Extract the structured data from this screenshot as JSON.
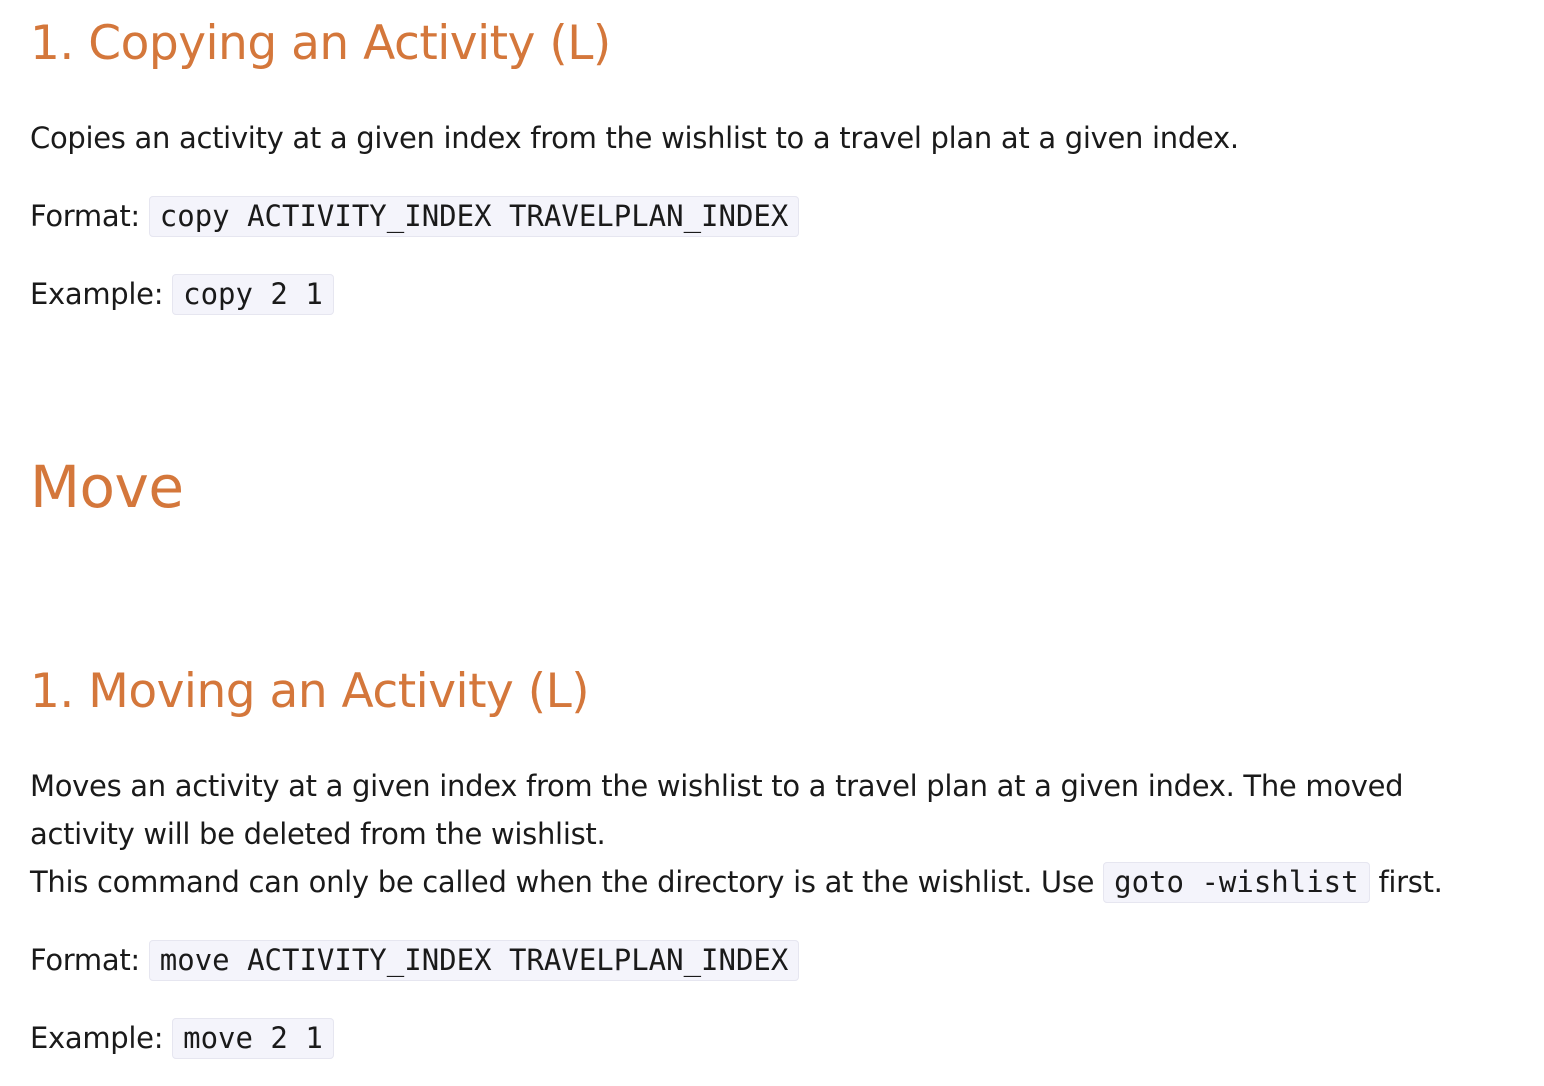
{
  "copy_section": {
    "heading": "1. Copying an Activity (L)",
    "description": "Copies an activity at a given index from the wishlist to a travel plan at a given index.",
    "format_label": "Format:",
    "format_code": "copy ACTIVITY_INDEX TRAVELPLAN_INDEX",
    "example_label": "Example:",
    "example_code": "copy 2 1"
  },
  "move_header": {
    "title": "Move"
  },
  "move_section": {
    "heading": "1. Moving an Activity (L)",
    "description_line1": "Moves an activity at a given index from the wishlist to a travel plan at a given index. The moved",
    "description_line2": "activity will be deleted from the wishlist.",
    "note_prefix": "This command can only be called when the directory is at the wishlist. Use",
    "note_code": "goto -wishlist",
    "note_suffix": "first.",
    "format_label": "Format:",
    "format_code": "move ACTIVITY_INDEX TRAVELPLAN_INDEX",
    "example_label": "Example:",
    "example_code": "move 2 1"
  },
  "colors": {
    "heading": "#d4773b",
    "text": "#1a1a1a",
    "code_background": "#f4f4fb",
    "code_border": "#e6e6f0"
  }
}
